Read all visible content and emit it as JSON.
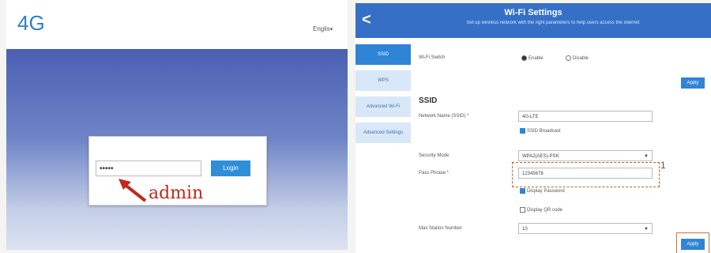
{
  "left": {
    "logo": "4G",
    "language": "Englis",
    "password_value": "•••••",
    "login_button": "Login",
    "annotation": "admin"
  },
  "right": {
    "title": "Wi-Fi Settings",
    "subtitle": "Set up wireless network with the right parameters to help users access the internet",
    "side_menu": [
      {
        "label": "SSID",
        "active": true
      },
      {
        "label": "WPS",
        "active": false
      },
      {
        "label": "Advanced Wi-Fi",
        "active": false
      },
      {
        "label": "Advanced Settings",
        "active": false
      }
    ],
    "wifi_switch": {
      "label": "Wi-Fi Switch",
      "enable": "Enable",
      "disable": "Disable"
    },
    "apply_label": "Apply",
    "ssid_section": "SSID",
    "network_name": {
      "label": "Network Name (SSID) *",
      "value": "4G-LTE"
    },
    "broadcast": "SSID Broadcast",
    "security_mode": {
      "label": "Security Mode",
      "value": "WPA2(AES)-PSK"
    },
    "pass_phrase": {
      "label": "Pass Phrase *",
      "value": "12345678"
    },
    "display_password": "Display Password",
    "display_qr": "Display QR code",
    "max_station": {
      "label": "Max Station Number",
      "value": "10"
    },
    "annotation_marker": "1"
  },
  "colors": {
    "brand_blue": "#2f84d6",
    "header_blue": "#3570c6",
    "annotation_red": "#c2281b"
  }
}
